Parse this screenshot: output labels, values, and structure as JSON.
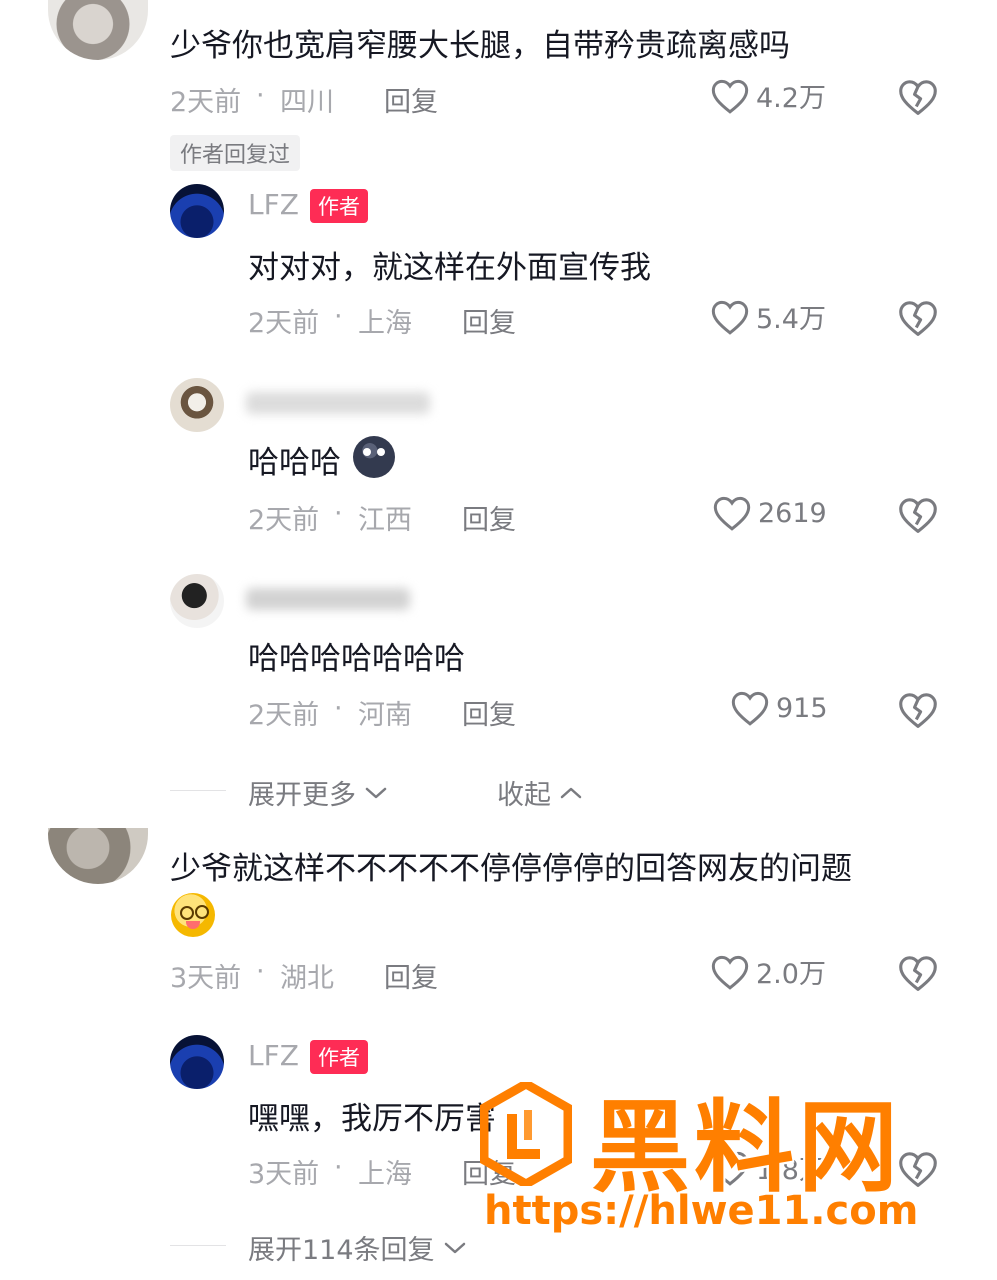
{
  "comments": [
    {
      "text": "少爷你也宽肩窄腰大长腿，自带矜贵疏离感吗",
      "date": "2天前",
      "location": "四川",
      "reply_label": "回复",
      "likes": "4.2万",
      "tag": "作者回复过"
    },
    {
      "author": "LFZ",
      "badge": "作者",
      "text": "对对对，就这样在外面宣传我",
      "date": "2天前",
      "location": "上海",
      "reply_label": "回复",
      "likes": "5.4万"
    },
    {
      "text": "哈哈哈",
      "date": "2天前",
      "location": "江西",
      "reply_label": "回复",
      "likes": "2619"
    },
    {
      "text": "哈哈哈哈哈哈哈",
      "date": "2天前",
      "location": "河南",
      "reply_label": "回复",
      "likes": "915"
    },
    {
      "text": "少爷就这样不不不不不停停停停的回答网友的问题",
      "date": "3天前",
      "location": "湖北",
      "reply_label": "回复",
      "likes": "2.0万"
    },
    {
      "author": "LFZ",
      "badge": "作者",
      "text": "嘿嘿，我厉不厉害",
      "date": "3天前",
      "location": "上海",
      "reply_label": "回复",
      "likes": "1.8万"
    }
  ],
  "thread_controls": {
    "expand_more": "展开更多",
    "collapse": "收起",
    "expand_replies": "展开114条回复"
  },
  "watermark": {
    "title": "黑料网",
    "url": "https://hlwe11.com"
  },
  "colors": {
    "author_badge": "#fe2c55",
    "watermark": "#ff7f00"
  }
}
